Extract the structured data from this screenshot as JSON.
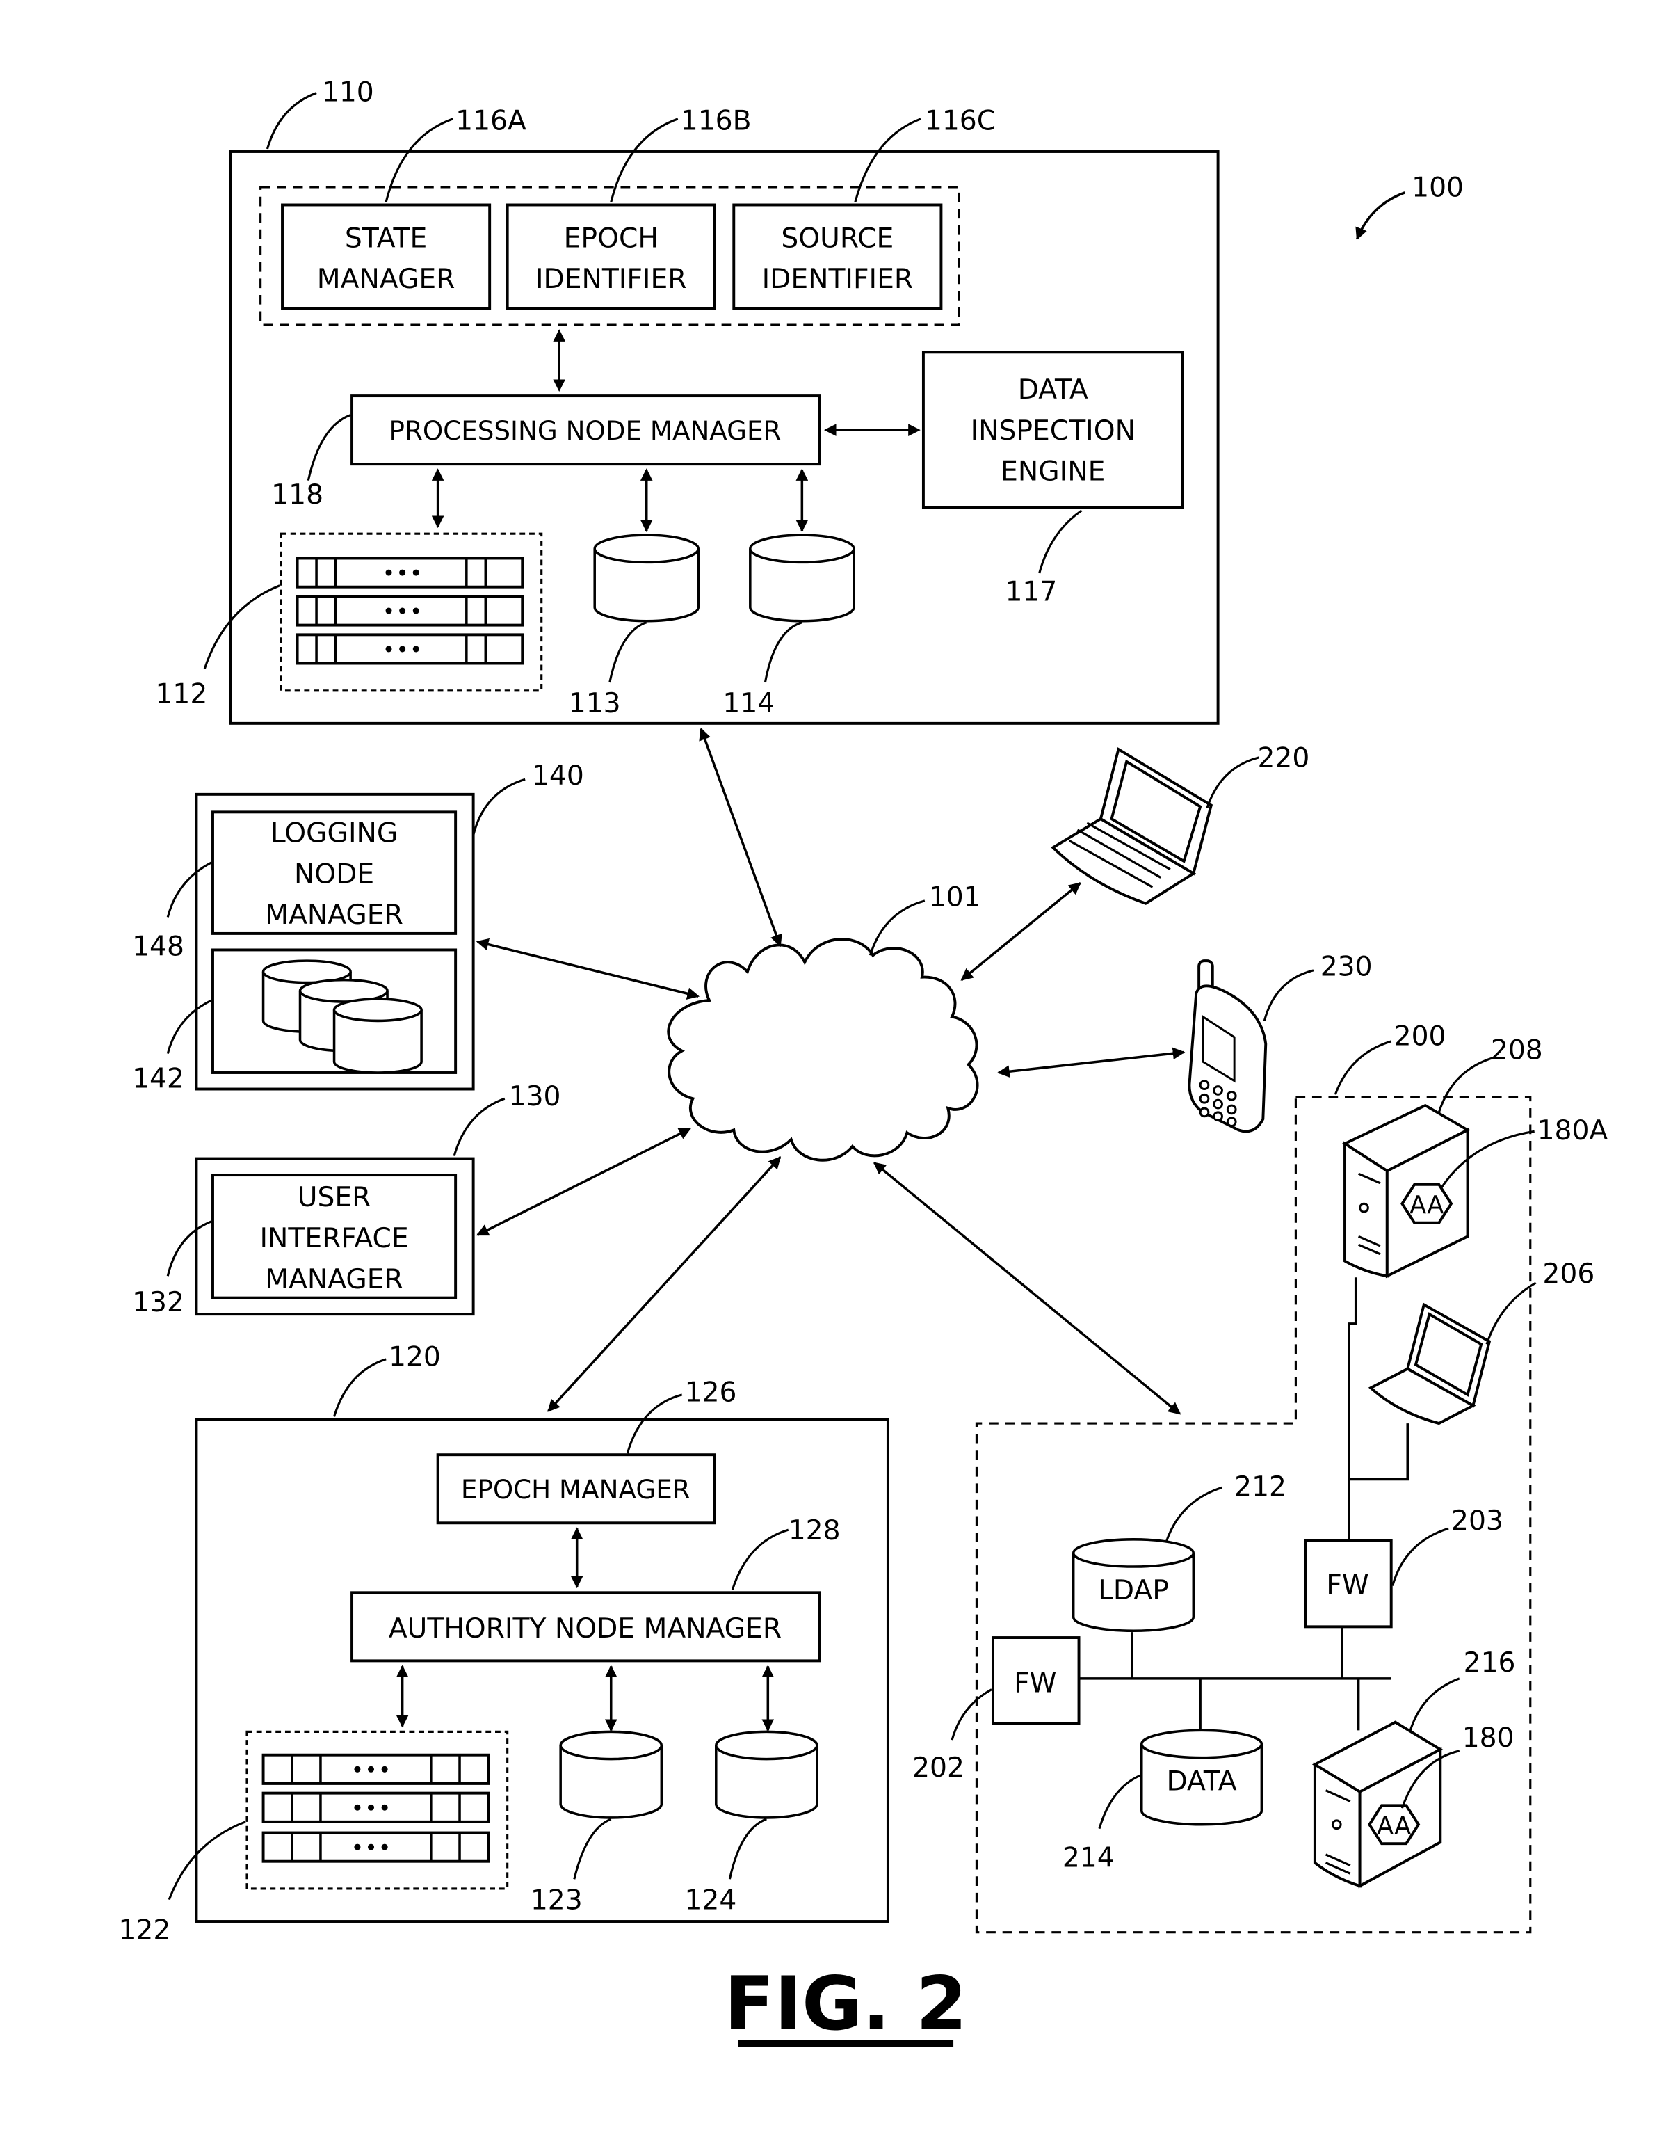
{
  "figure": {
    "title": "FIG. 2",
    "system_ref": "100"
  },
  "processing_node": {
    "ref": "110",
    "state_manager": {
      "ref": "116A",
      "lines": [
        "STATE",
        "MANAGER"
      ]
    },
    "epoch_identifier": {
      "ref": "116B",
      "lines": [
        "EPOCH",
        "IDENTIFIER"
      ]
    },
    "source_identifier": {
      "ref": "116C",
      "lines": [
        "SOURCE",
        "IDENTIFIER"
      ]
    },
    "processing_node_manager": {
      "ref": "118",
      "label": "PROCESSING NODE MANAGER"
    },
    "data_inspection_engine": {
      "ref": "117",
      "lines": [
        "DATA",
        "INSPECTION",
        "ENGINE"
      ]
    },
    "server_rack": {
      "ref": "112"
    },
    "database_1": {
      "ref": "113"
    },
    "database_2": {
      "ref": "114"
    }
  },
  "network": {
    "ref": "101"
  },
  "logging_node": {
    "ref": "140",
    "logging_node_manager": {
      "ref": "148",
      "lines": [
        "LOGGING",
        "NODE",
        "MANAGER"
      ]
    },
    "log_storage": {
      "ref": "142"
    }
  },
  "user_interface_node": {
    "ref": "130",
    "user_interface_manager": {
      "ref": "132",
      "lines": [
        "USER",
        "INTERFACE",
        "MANAGER"
      ]
    }
  },
  "authority_node": {
    "ref": "120",
    "epoch_manager": {
      "ref": "126",
      "label": "EPOCH MANAGER"
    },
    "authority_node_manager": {
      "ref": "128",
      "label": "AUTHORITY NODE MANAGER"
    },
    "server_rack": {
      "ref": "122"
    },
    "database_1": {
      "ref": "123"
    },
    "database_2": {
      "ref": "124"
    }
  },
  "client_devices": {
    "laptop": {
      "ref": "220"
    },
    "mobile_phone": {
      "ref": "230"
    }
  },
  "enterprise_network": {
    "ref": "200",
    "server_top": {
      "ref": "208",
      "agent_ref": "180A",
      "agent_label": "AA"
    },
    "laptop": {
      "ref": "206"
    },
    "firewall_inner": {
      "ref": "203",
      "label": "FW"
    },
    "firewall_outer": {
      "ref": "202",
      "label": "FW"
    },
    "ldap": {
      "ref": "212",
      "label": "LDAP"
    },
    "data_store": {
      "ref": "214",
      "label": "DATA"
    },
    "server_bottom": {
      "ref": "216",
      "agent_ref": "180",
      "agent_label": "AA"
    }
  }
}
